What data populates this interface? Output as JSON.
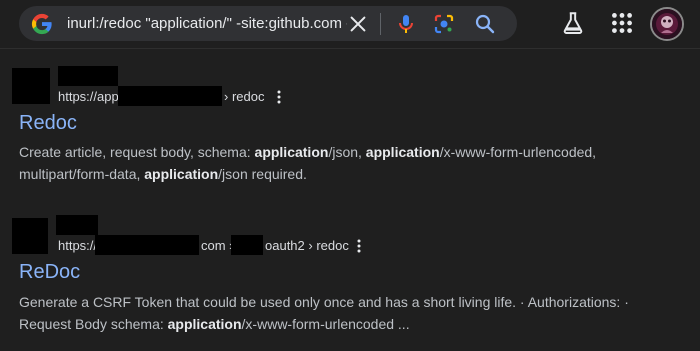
{
  "search": {
    "query": "inurl:/redoc \"application/\" -site:github.com -"
  },
  "results": [
    {
      "url_prefix": "https://app",
      "url_suffix": " › redoc",
      "title": "Redoc",
      "snippet": [
        {
          "t": "Create article, request body, schema: ",
          "b": false
        },
        {
          "t": "application",
          "b": true
        },
        {
          "t": "/json, ",
          "b": false
        },
        {
          "t": "application",
          "b": true
        },
        {
          "t": "/x-www-form-urlencoded, multipart/form-data, ",
          "b": false
        },
        {
          "t": "application",
          "b": true
        },
        {
          "t": "/json required.",
          "b": false
        }
      ]
    },
    {
      "url_prefix": "https://",
      "url_mid": "com ›",
      "url_suffix": "oauth2 › redoc",
      "title": "ReDoc",
      "snippet": [
        {
          "t": "Generate a CSRF Token that could be used only once and has a short living life. · Authorizations: · Request Body schema: ",
          "b": false
        },
        {
          "t": "application",
          "b": true
        },
        {
          "t": "/x-www-form-urlencoded ...",
          "b": false
        }
      ]
    }
  ],
  "icons": {
    "google_logo": "google-g-icon",
    "clear": "close-icon",
    "voice": "mic-icon",
    "lens": "lens-icon",
    "search": "search-icon",
    "labs": "flask-icon",
    "apps": "grid-icon",
    "more": "kebab-icon"
  },
  "colors": {
    "background": "#1f1f1f",
    "searchbox": "#303134",
    "link": "#8ab4f8",
    "text": "#bdc1c6"
  }
}
